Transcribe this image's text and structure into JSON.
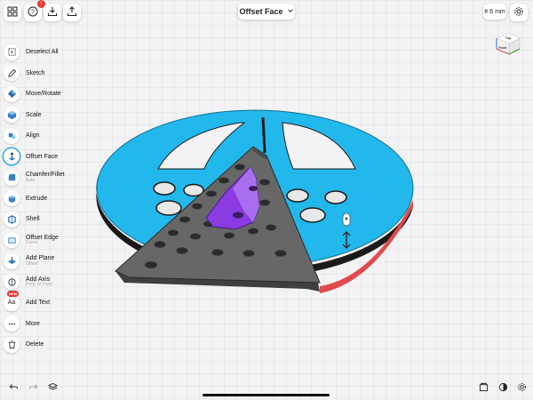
{
  "top_bar": {
    "apps_icon": "apps-grid-icon",
    "help_icon": "help-icon",
    "help_badge": "!",
    "import_icon": "import-icon",
    "share_icon": "share-icon",
    "mode_title": "Offset Face",
    "grid_prefix": "#",
    "grid_value": "6",
    "grid_unit": "mm",
    "settings_icon": "settings-gear-icon"
  },
  "sidebar": {
    "tools": [
      {
        "label": "Deselect All",
        "sub": "",
        "icon": "deselect-icon"
      },
      {
        "label": "Sketch",
        "sub": "",
        "icon": "sketch-pencil-icon"
      },
      {
        "label": "Move/Rotate",
        "sub": "",
        "icon": "move-rotate-icon"
      },
      {
        "label": "Scale",
        "sub": "",
        "icon": "scale-icon"
      },
      {
        "label": "Align",
        "sub": "",
        "icon": "align-icon"
      },
      {
        "label": "Offset Face",
        "sub": "",
        "icon": "offset-face-icon"
      },
      {
        "label": "Chamfer/Fillet",
        "sub": "Auto",
        "icon": "chamfer-fillet-icon"
      },
      {
        "label": "Extrude",
        "sub": "",
        "icon": "extrude-icon"
      },
      {
        "label": "Shell",
        "sub": "",
        "icon": "shell-icon"
      },
      {
        "label": "Offset Edge",
        "sub": "Curve",
        "icon": "offset-edge-icon"
      },
      {
        "label": "Add Plane",
        "sub": "Offset",
        "icon": "add-plane-icon"
      },
      {
        "label": "Add Axis",
        "sub": "Perp. to Face",
        "icon": "add-axis-icon"
      },
      {
        "label": "Add Text",
        "sub": "",
        "icon": "add-text-icon",
        "badge": "NEW"
      },
      {
        "label": "More",
        "sub": "",
        "icon": "more-dots-icon"
      },
      {
        "label": "Delete",
        "sub": "",
        "icon": "trash-icon"
      }
    ]
  },
  "viewcube": {
    "top_label": "Top",
    "front_label": "Front"
  },
  "bottom_bar": {
    "undo_icon": "undo-icon",
    "redo_icon": "redo-icon",
    "layers_icon": "layers-icon",
    "library_icon": "library-icon",
    "render_icon": "render-mode-icon",
    "settings_icon": "settings-icon"
  },
  "colors": {
    "accent": "#2aa6e0",
    "disc_top": "#22b8ec",
    "disc_side": "#1a1a1a",
    "triangle": "#676767",
    "selected_face": "#8a3be2",
    "selection_edge": "#e04b4b"
  }
}
